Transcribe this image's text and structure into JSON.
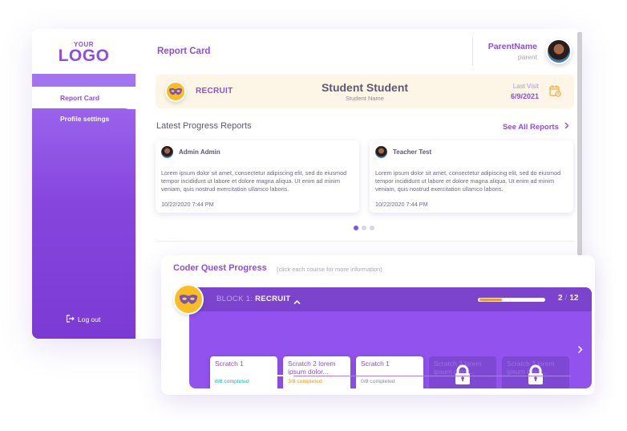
{
  "logo": {
    "top": "YOUR",
    "main": "LOGO"
  },
  "sidebar": {
    "items": [
      {
        "label": "Report Card",
        "active": true
      },
      {
        "label": "Profile settings",
        "active": false
      }
    ],
    "logout_label": "Log out"
  },
  "header": {
    "title": "Report Card",
    "user_name": "ParentName",
    "user_role": "parent"
  },
  "student_banner": {
    "rank": "RECRUIT",
    "student_name": "Student Student",
    "student_name_caption": "Student Name",
    "last_visit_label": "Last Visit",
    "last_visit_date": "6/9/2021"
  },
  "progress_reports": {
    "title": "Latest Progress Reports",
    "see_all_label": "See All Reports",
    "reports": [
      {
        "author": "Admin Admin",
        "body": "Lorem ipsum dolor sit amet, consectetur adipiscing elit, sed do eiusmod tempor incididunt ut labore et dolore magna aliqua. Ut enim ad minim veniam, quis nostrud exercitation ullamco laboris.",
        "timestamp": "10/22/2020  7:44 PM"
      },
      {
        "author": "Teacher Test",
        "body": "Lorem ipsum dolor sit amet, consectetur adipiscing elit, sed do eiusmod tempor incididunt ut labore et dolore magna aliqua. Ut enim ad minim veniam, quis nostrud exercitation ullamco laboris.",
        "timestamp": "10/22/2020  7:44 PM"
      }
    ],
    "pagination": {
      "pages": 3,
      "current": 1
    }
  },
  "coder_quest": {
    "title": "Coder Quest Progress",
    "hint": "(click each course for more information)",
    "block": {
      "prefix": "BLOCK 1:",
      "name": "RECRUIT",
      "completed": 2,
      "total": 12,
      "separator": "/",
      "progress_fraction": 0.35,
      "scroll_fraction": 0.23
    },
    "courses": [
      {
        "title": "Scratch 1",
        "status": "8/8  completed",
        "progress": 1.0,
        "color": "#19b5b5",
        "locked": false
      },
      {
        "title": "Scratch 2 lorem ipsum dolor...",
        "status": "3/8  completed",
        "progress": 0.375,
        "color": "#f39a12",
        "locked": false
      },
      {
        "title": "Scratch 1",
        "status": "0/8  completed",
        "progress": 0.0,
        "color": "#8b8aa0",
        "locked": false
      },
      {
        "title": "Scratch 2 lorem ipsum dolor...",
        "status": "",
        "progress": 0,
        "color": "",
        "locked": true
      },
      {
        "title": "Scratch 2 lorem ipsum dolor...",
        "status": "",
        "progress": 0,
        "color": "",
        "locked": true
      }
    ]
  },
  "colors": {
    "accent": "#8b4fe6",
    "block_bg": "#9152ee",
    "block_header": "#7c43cc",
    "badge_yellow": "#fbbd22",
    "banner_bg": "#fdf6e7"
  }
}
